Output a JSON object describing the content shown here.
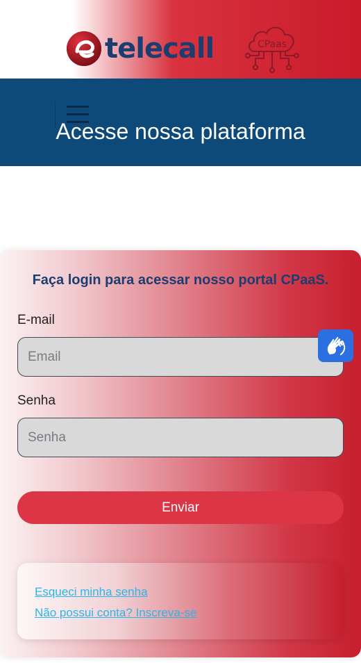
{
  "header": {
    "brand_name": "telecall",
    "cpaas_badge": "CPaas",
    "colors": {
      "navy": "#1b3d6f",
      "red": "#c91a2a",
      "nav_bg": "#0d4a7a"
    }
  },
  "navbar": {
    "menu_icon": "hamburger-icon",
    "title": "Acesse nossa plataforma"
  },
  "login": {
    "title": "Faça login para acessar nosso portal CPaaS.",
    "email_label": "E-mail",
    "email_placeholder": "Email",
    "email_value": "",
    "password_label": "Senha",
    "password_placeholder": "Senha",
    "password_value": "",
    "submit_label": "Enviar",
    "submit_color": "#dc3545"
  },
  "links": {
    "forgot_password": "Esqueci minha senha",
    "signup": "Não possui conta? Inscreva-se",
    "link_color": "#29b6e8"
  },
  "accessibility": {
    "icon": "sign-language-hands-icon",
    "color": "#2b6fe0"
  }
}
